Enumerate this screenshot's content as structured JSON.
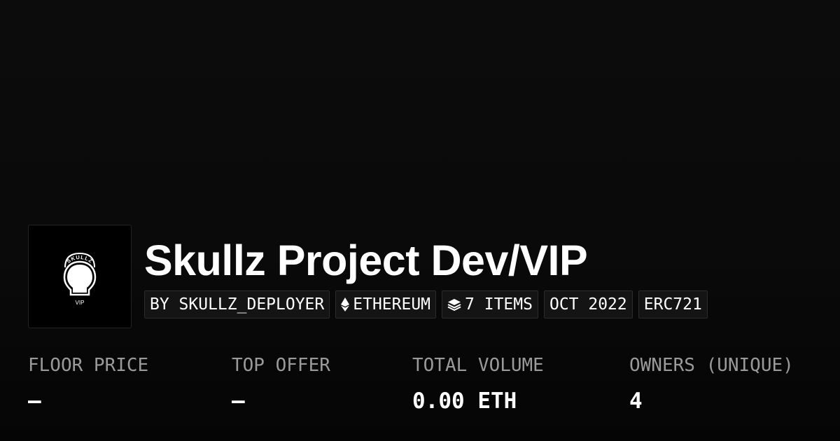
{
  "collection": {
    "name": "Skullz Project Dev/VIP",
    "logo": {
      "icon": "skull-logo-icon",
      "text_top": "SKULLZ",
      "text_bottom": "VIP"
    }
  },
  "badges": [
    {
      "label": "BY SKULLZ_DEPLOYER",
      "icon": null
    },
    {
      "label": "ETHEREUM",
      "icon": "ethereum-icon"
    },
    {
      "label": "7 ITEMS",
      "icon": "layers-icon"
    },
    {
      "label": "OCT 2022",
      "icon": null
    },
    {
      "label": "ERC721",
      "icon": null
    }
  ],
  "stats": [
    {
      "label": "FLOOR PRICE",
      "value": "—"
    },
    {
      "label": "TOP OFFER",
      "value": "—"
    },
    {
      "label": "TOTAL VOLUME",
      "value": "0.00 ETH"
    },
    {
      "label": "OWNERS (UNIQUE)",
      "value": "4"
    }
  ],
  "colors": {
    "background": "#0a0a0a",
    "text": "#ffffff",
    "muted": "#9a9a9a",
    "badge_bg": "#141414",
    "badge_border": "#2c2c2c"
  }
}
